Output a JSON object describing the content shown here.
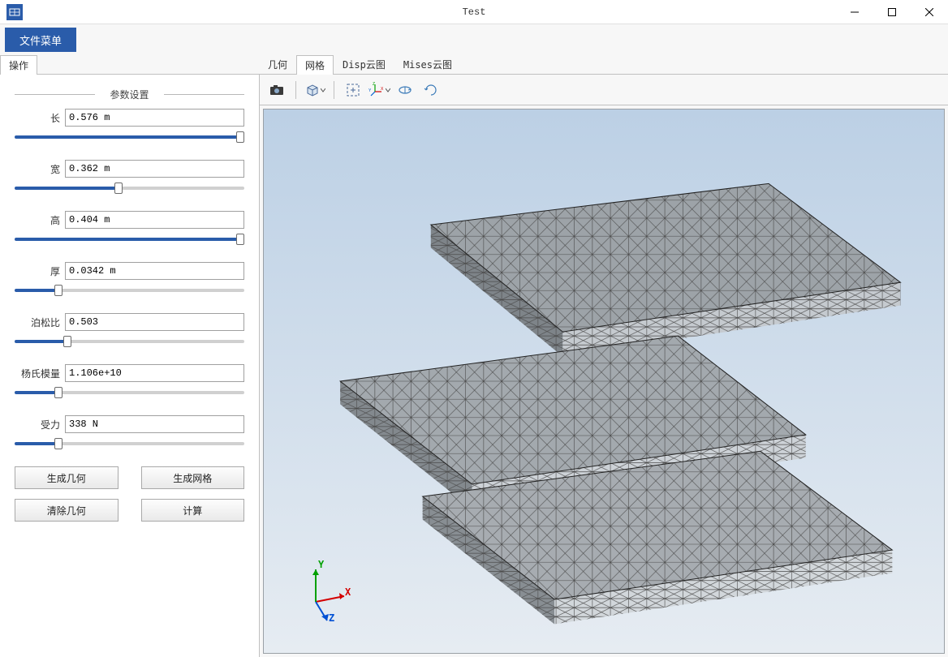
{
  "window": {
    "title": "Test"
  },
  "menu": {
    "file_menu": "文件菜单"
  },
  "tabs": {
    "left": "操作",
    "right": [
      "几何",
      "网格",
      "Disp云图",
      "Mises云图"
    ],
    "active_right": 1
  },
  "panel": {
    "legend": "参数设置",
    "fields": [
      {
        "label": "长",
        "value": "0.576 m",
        "pct": 100
      },
      {
        "label": "宽",
        "value": "0.362 m",
        "pct": 45
      },
      {
        "label": "高",
        "value": "0.404 m",
        "pct": 100
      },
      {
        "label": "厚",
        "value": "0.0342 m",
        "pct": 18
      },
      {
        "label": "泊松比",
        "value": "0.503",
        "pct": 22
      },
      {
        "label": "杨氏模量",
        "value": "1.106e+10",
        "pct": 18
      },
      {
        "label": "受力",
        "value": "338 N",
        "pct": 18
      }
    ],
    "buttons": {
      "gen_geom": "生成几何",
      "gen_mesh": "生成网格",
      "clear_geom": "清除几何",
      "compute": "计算"
    }
  },
  "toolbar": {
    "icons": [
      "camera-icon",
      "view-cube-icon",
      "fit-icon",
      "axes-icon",
      "rotate-x-icon",
      "rotate-y-icon"
    ]
  },
  "triad": {
    "x": "X",
    "y": "Y",
    "z": "Z"
  }
}
